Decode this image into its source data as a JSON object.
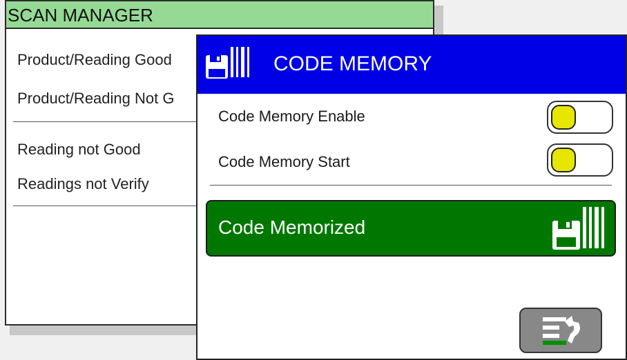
{
  "scan_manager": {
    "title": "SCAN MANAGER",
    "items": [
      "Product/Reading Good",
      "Product/Reading Not G",
      "Reading not Good",
      "Readings not Verify"
    ]
  },
  "code_memory": {
    "title": "CODE MEMORY",
    "title_icon": "floppy-barcode-icon",
    "rows": [
      {
        "label": "Code Memory Enable",
        "state": "off"
      },
      {
        "label": "Code Memory Start",
        "state": "off"
      }
    ],
    "memorized_button": {
      "label": "Code Memorized",
      "icon": "floppy-barcode-icon"
    },
    "back_button_icon": "return-list-icon"
  },
  "colors": {
    "scan_manager_title_bg": "#95d995",
    "code_memory_title_bg": "#0000e6",
    "memorized_bg": "#007800",
    "toggle_knob": "#e6e600",
    "back_button_bg": "#888888"
  }
}
